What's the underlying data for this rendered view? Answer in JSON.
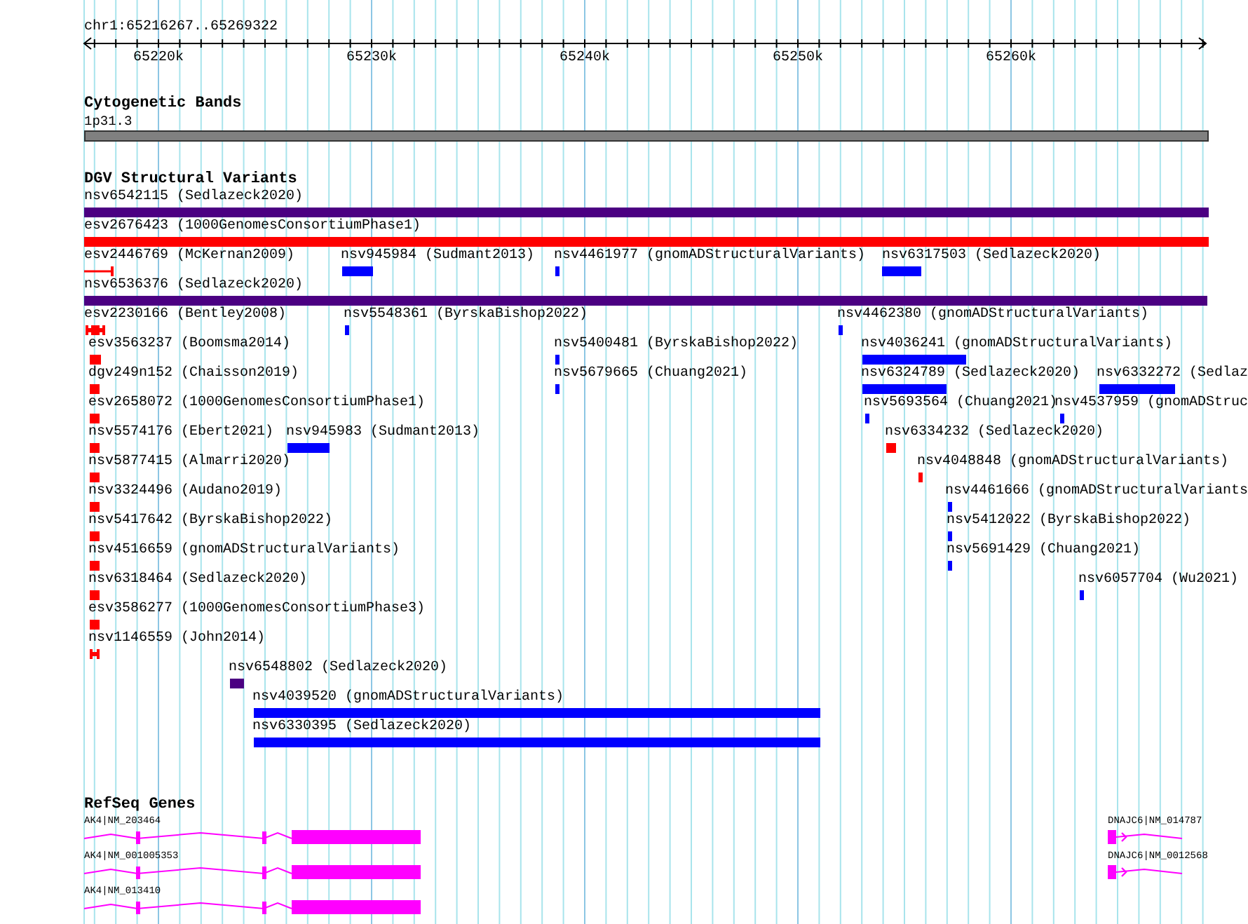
{
  "ruler": {
    "location": "chr1:65216267..65269322",
    "ticks": [
      "65220k",
      "65230k",
      "65240k",
      "65250k",
      "65260k"
    ]
  },
  "bands": {
    "title": "Cytogenetic Bands",
    "features": [
      {
        "label": "1p31.3"
      }
    ]
  },
  "variants": {
    "title": "DGV Structural Variants",
    "features": [
      {
        "label": "nsv6542115 (Sedlazeck2020)",
        "color": "#4b0082",
        "kind": "bar"
      },
      {
        "label": "esv2676423 (1000GenomesConsortiumPhase1)",
        "color": "#ff0000",
        "kind": "bar"
      },
      {
        "label": "esv2446769 (McKernan2009)",
        "color": "#ff0000",
        "kind": "line"
      },
      {
        "label": "nsv945984 (Sudmant2013)",
        "color": "#0000ff",
        "kind": "bar"
      },
      {
        "label": "nsv4461977 (gnomADStructuralVariants)",
        "color": "#0000ff",
        "kind": "bar"
      },
      {
        "label": "nsv6317503 (Sedlazeck2020)",
        "color": "#0000ff",
        "kind": "bar"
      },
      {
        "label": "nsv6536376 (Sedlazeck2020)",
        "color": "#4b0082",
        "kind": "bar"
      },
      {
        "label": "esv2230166 (Bentley2008)",
        "color": "#ff0000",
        "kind": "split"
      },
      {
        "label": "nsv5548361 (ByrskaBishop2022)",
        "color": "#0000ff",
        "kind": "bar"
      },
      {
        "label": "nsv4462380 (gnomADStructuralVariants)",
        "color": "#0000ff",
        "kind": "bar"
      },
      {
        "label": "esv3563237 (Boomsma2014)",
        "color": "#ff0000",
        "kind": "bar"
      },
      {
        "label": "nsv5400481 (ByrskaBishop2022)",
        "color": "#0000ff",
        "kind": "bar"
      },
      {
        "label": "nsv4036241 (gnomADStructuralVariants)",
        "color": "#0000ff",
        "kind": "bar"
      },
      {
        "label": "dgv249n152 (Chaisson2019)",
        "color": "#ff0000",
        "kind": "bar"
      },
      {
        "label": "nsv5679665 (Chuang2021)",
        "color": "#0000ff",
        "kind": "bar"
      },
      {
        "label": "nsv6324789 (Sedlazeck2020)",
        "color": "#0000ff",
        "kind": "bar"
      },
      {
        "label": "nsv6332272 (Sedlaz",
        "color": "#0000ff",
        "kind": "bar"
      },
      {
        "label": "esv2658072 (1000GenomesConsortiumPhase1)",
        "color": "#ff0000",
        "kind": "bar"
      },
      {
        "label": "nsv5693564 (Chuang2021)",
        "color": "#0000ff",
        "kind": "bar"
      },
      {
        "label": "nsv4537959 (gnomADStruc",
        "color": "#0000ff",
        "kind": "bar"
      },
      {
        "label": "nsv5574176 (Ebert2021)",
        "color": "#ff0000",
        "kind": "bar"
      },
      {
        "label": "nsv945983 (Sudmant2013)",
        "color": "#0000ff",
        "kind": "bar"
      },
      {
        "label": "nsv6334232 (Sedlazeck2020)",
        "color": "#ff0000",
        "kind": "bar"
      },
      {
        "label": "nsv5877415 (Almarri2020)",
        "color": "#ff0000",
        "kind": "bar"
      },
      {
        "label": "nsv4048848 (gnomADStructuralVariants)",
        "color": "#ff0000",
        "kind": "bar"
      },
      {
        "label": "nsv3324496 (Audano2019)",
        "color": "#ff0000",
        "kind": "bar"
      },
      {
        "label": "nsv4461666 (gnomADStructuralVariants",
        "color": "#0000ff",
        "kind": "bar"
      },
      {
        "label": "nsv5417642 (ByrskaBishop2022)",
        "color": "#ff0000",
        "kind": "bar"
      },
      {
        "label": "nsv5412022 (ByrskaBishop2022)",
        "color": "#0000ff",
        "kind": "bar"
      },
      {
        "label": "nsv4516659 (gnomADStructuralVariants)",
        "color": "#ff0000",
        "kind": "bar"
      },
      {
        "label": "nsv5691429 (Chuang2021)",
        "color": "#0000ff",
        "kind": "bar"
      },
      {
        "label": "nsv6318464 (Sedlazeck2020)",
        "color": "#ff0000",
        "kind": "bar"
      },
      {
        "label": "nsv6057704 (Wu2021)",
        "color": "#0000ff",
        "kind": "bar"
      },
      {
        "label": "esv3586277 (1000GenomesConsortiumPhase3)",
        "color": "#ff0000",
        "kind": "bar"
      },
      {
        "label": "nsv1146559 (John2014)",
        "color": "#ff0000",
        "kind": "split"
      },
      {
        "label": "nsv6548802 (Sedlazeck2020)",
        "color": "#4b0082",
        "kind": "bar"
      },
      {
        "label": "nsv4039520 (gnomADStructuralVariants)",
        "color": "#0000ff",
        "kind": "bar"
      },
      {
        "label": "nsv6330395 (Sedlazeck2020)",
        "color": "#0000ff",
        "kind": "bar"
      }
    ]
  },
  "genes": {
    "title": "RefSeq Genes",
    "features": [
      {
        "label": "AK4|NM_203464"
      },
      {
        "label": "DNAJC6|NM_014787"
      },
      {
        "label": "AK4|NM_001005353"
      },
      {
        "label": "DNAJC6|NM_0012568"
      },
      {
        "label": "AK4|NM_013410"
      }
    ]
  }
}
